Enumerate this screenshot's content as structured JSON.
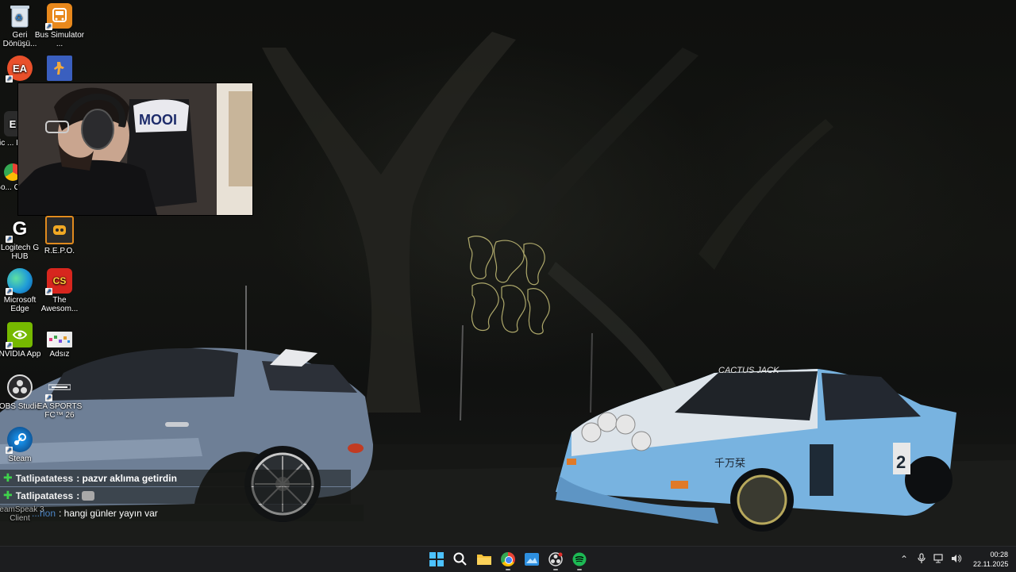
{
  "desktop_icons": [
    {
      "label": "Geri Dönüşü...",
      "icon": "recycle-bin-icon"
    },
    {
      "label": "Bus Simulator ...",
      "icon": "bus-simulator-icon"
    },
    {
      "label": "EA",
      "icon": "ea-app-icon"
    },
    {
      "label": "",
      "icon": "counter-strike-icon"
    },
    {
      "label": "Epic ... Lau...",
      "icon": "epic-games-launcher-icon"
    },
    {
      "label": "Go... Ch...",
      "icon": "google-chrome-icon"
    },
    {
      "label": "Logitech G HUB",
      "icon": "logitech-g-hub-icon"
    },
    {
      "label": "R.E.P.O.",
      "icon": "repo-game-icon"
    },
    {
      "label": "Microsoft Edge",
      "icon": "microsoft-edge-icon"
    },
    {
      "label": "The Awesom...",
      "icon": "the-awesome-cs-icon"
    },
    {
      "label": "NVIDIA App",
      "icon": "nvidia-app-icon"
    },
    {
      "label": "Adsız",
      "icon": "adsiz-image-icon"
    },
    {
      "label": "OBS Studio",
      "icon": "obs-studio-icon"
    },
    {
      "label": "EA SPORTS FC™ 26",
      "icon": "ea-sports-fc-icon"
    },
    {
      "label": "Steam",
      "icon": "steam-icon"
    },
    {
      "label": "TeamSpeak 3 Client",
      "icon": "teamspeak-icon"
    }
  ],
  "chat": [
    {
      "user": "Tatlipatatess",
      "message": ": pazvr aklıma getirdin"
    },
    {
      "user": "Tatlipatatess",
      "message": ": "
    },
    {
      "user": "...rion",
      "message": ": hangi günler yayın var"
    }
  ],
  "taskbar": {
    "apps": [
      "windows-start-icon",
      "search-icon",
      "file-explorer-icon",
      "chrome-icon",
      "photos-icon",
      "obs-icon",
      "spotify-icon"
    ]
  },
  "tray": {
    "time": "00:28",
    "date": "22.11.2025"
  },
  "colors": {
    "taskbar_bg": "#1c1d1f",
    "chat_plus": "#3fd24c",
    "spotify": "#1db954"
  }
}
